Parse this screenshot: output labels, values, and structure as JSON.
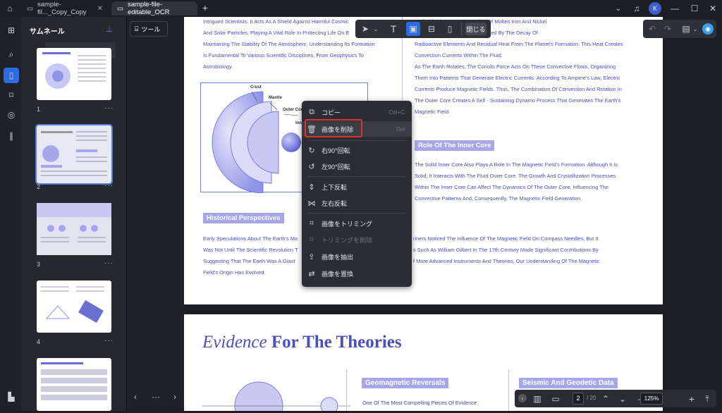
{
  "titlebar": {
    "tabs": [
      {
        "label": "sample-fil..._Copy_Copy"
      },
      {
        "label": "sample-file-editable_OCR"
      }
    ],
    "avatar": "K"
  },
  "sidebar": {
    "title": "サムネール",
    "pages": [
      "1",
      "2",
      "3",
      "4"
    ]
  },
  "toolbar": {
    "tools_label": "ツール",
    "close_label": "閉じる"
  },
  "page1": {
    "left_lines": [
      "Intrigued Scientists. It Acts As A Shield Against Harmful Cosmic",
      "And Solar Particles, Playing A Vital Role In Protecting Life On E",
      "Maintaining The Stability Of The Atmosphere. Understanding Its Formation",
      "Is Fundamental To Various Scientific Disciplines, From Geophysics To",
      "Astrobiology."
    ],
    "right_lines": [
      "e Of This Theory Is The Motion Of Molten Iron And Nickel",
      "Outer Core Is A Fluid Layer, Heated By The Decay Of",
      "Radioactive Elements And Residual Heat From The Planet's Formation. This Heat Creates",
      "Convection Currents Within The Fluid.",
      "As The Earth Rotates, The Coriolis Force Acts On These Convective Flows, Organizing",
      "Them Into Patterns That Generate Electric Currents. According To Ampere's Law, Electric",
      "Currents Produce Magnetic Fields. Thus, The Combination Of Convection And Rotation In",
      "The Outer Core Creates A Self - Sustaining Dynamo Process That Generates The Earth's",
      "Magnetic Field."
    ],
    "diagram_labels": {
      "crust": "Crust",
      "mantle": "Mantle",
      "outer_core": "Outer Core",
      "inner": "Inn"
    },
    "inner_core_heading": "Role Of The Inner Core",
    "inner_core_lines": [
      "The Solid Inner Core Also Plays A Role In The Magnetic Field's Formation. Although It Is",
      "Solid, It Interacts With The Fluid Outer Core. The Growth And Crystallization Processes",
      "Within The Inner Core Can Affect The Dynamics Of The Outer Core, Influencing The",
      "Convective Patterns And, Consequently, The Magnetic Field Generation."
    ],
    "historical_heading": "Historical Perspectives",
    "hist_left": [
      "Early Speculations About The Earth's Ma",
      "Was Not Until The Scientific Revolution T",
      "Suggesting That The Earth Was A Giant",
      "Field's Origin Has Evolved."
    ],
    "hist_right": [
      "riners Noticed The Influence Of The Magnetic Field On Compass Needles, But It",
      "s Such As William Gilbert In The 17th Century Made Significant Contributions By",
      "f More Advanced Instruments And Theories, Our Understanding Of The Magnetic",
      ""
    ]
  },
  "page2": {
    "title_em": "Evidence",
    "title_rest": " For The Theories",
    "geo_heading": "Geomagnetic Reversals",
    "seis_heading": "Seismic And Geodetic Data",
    "geo_line": "One Of The Most Compelling Pieces Of Evidence"
  },
  "menu": {
    "items": [
      {
        "label": "コピー",
        "shortcut": "Ctrl+C"
      },
      {
        "label": "画像を削除",
        "shortcut": "Del"
      },
      {
        "label": "右90°回転"
      },
      {
        "label": "左90°回転"
      },
      {
        "label": "上下反転"
      },
      {
        "label": "左右反転"
      },
      {
        "label": "画像をトリミング"
      },
      {
        "label": "トリミングを削除"
      },
      {
        "label": "画像を抽出"
      },
      {
        "label": "画像を置換"
      }
    ]
  },
  "bottombar": {
    "page": "2",
    "total": "/ 20",
    "zoom": "125%"
  },
  "colors": {
    "accent": "#2d6cdf",
    "highlight": "#e03030",
    "doc_text": "#4a4fbd"
  }
}
